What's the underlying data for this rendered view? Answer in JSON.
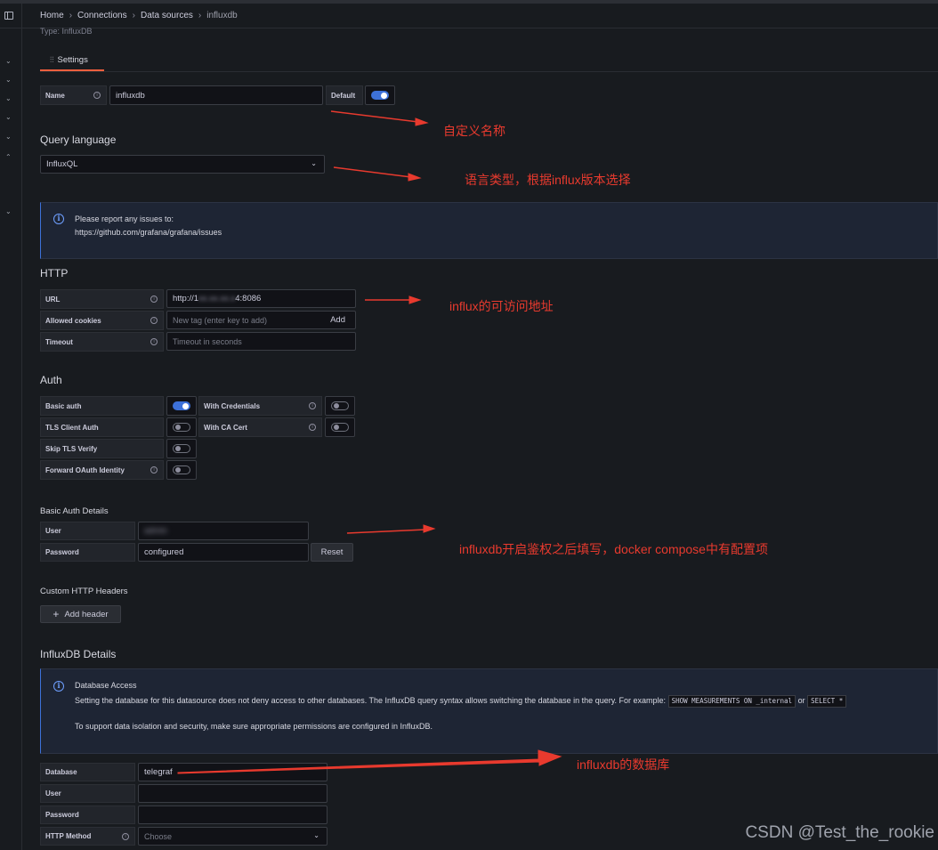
{
  "breadcrumb": [
    "Home",
    "Connections",
    "Data sources",
    "influxdb"
  ],
  "type_line": "Type: InfluxDB",
  "tab": {
    "label": "Settings",
    "accent": "#f55f3e"
  },
  "name_field": {
    "label": "Name",
    "value": "influxdb",
    "default_label": "Default",
    "default_on": true
  },
  "query_language": {
    "title": "Query language",
    "value": "InfluxQL"
  },
  "report_alert": {
    "line1": "Please report any issues to:",
    "line2": "https://github.com/grafana/grafana/issues"
  },
  "http": {
    "title": "HTTP",
    "url_label": "URL",
    "url_value": "http://1",
    "url_blurred": "xx.xx.xx.x",
    "url_tail": "4:8086",
    "cookies_label": "Allowed cookies",
    "cookies_placeholder": "New tag (enter key to add)",
    "cookies_add": "Add",
    "timeout_label": "Timeout",
    "timeout_placeholder": "Timeout in seconds"
  },
  "auth": {
    "title": "Auth",
    "basic_auth": "Basic auth",
    "basic_auth_on": true,
    "with_credentials": "With Credentials",
    "with_credentials_on": false,
    "tls_client_auth": "TLS Client Auth",
    "tls_client_auth_on": false,
    "with_ca_cert": "With CA Cert",
    "with_ca_cert_on": false,
    "skip_tls": "Skip TLS Verify",
    "skip_tls_on": false,
    "forward_oauth": "Forward OAuth Identity",
    "forward_oauth_on": false
  },
  "basic_auth_details": {
    "title": "Basic Auth Details",
    "user_label": "User",
    "user_value": "admin",
    "password_label": "Password",
    "password_value": "configured",
    "reset": "Reset"
  },
  "custom_headers": {
    "title": "Custom HTTP Headers",
    "add_button": "Add header"
  },
  "influx_details": {
    "title": "InfluxDB Details",
    "alert_title": "Database Access",
    "alert_line1_pre": "Setting the database for this datasource does not deny access to other databases. The InfluxDB query syntax allows switching the database in the query. For example:",
    "code1": "SHOW MEASUREMENTS ON _internal",
    "or": "or",
    "code2": "SELECT *",
    "alert_line2": "To support data isolation and security, make sure appropriate permissions are configured in InfluxDB.",
    "database_label": "Database",
    "database_value": "telegraf",
    "user_label": "User",
    "password_label": "Password",
    "http_method_label": "HTTP Method",
    "http_method_placeholder": "Choose"
  },
  "annotations": {
    "name": "自定义名称",
    "language": "语言类型，根据influx版本选择",
    "url": "influx的可访问地址",
    "auth": "influxdb开启鉴权之后填写，docker compose中有配置项",
    "database": "influxdb的数据库",
    "color": "#e83a2e"
  },
  "watermark": "CSDN @Test_the_rookie"
}
